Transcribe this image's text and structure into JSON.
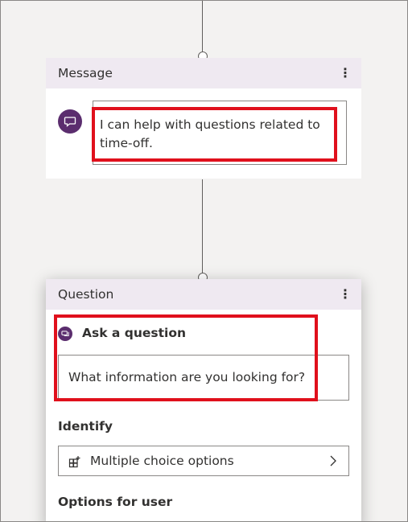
{
  "message_node": {
    "title": "Message",
    "menu_glyph": "⋮",
    "avatar_icon": "chat-bubble-icon",
    "text": "I can help with questions related to time-off."
  },
  "question_node": {
    "title": "Question",
    "menu_glyph": "⋮",
    "section_icon": "chat-bubbles-icon",
    "heading": "Ask a question",
    "question_text": "What information are you looking for?",
    "identify": {
      "label": "Identify",
      "value": "Multiple choice options",
      "icon": "grid-plus-icon"
    },
    "options_label": "Options for user"
  },
  "colors": {
    "header_bg": "#efe9f1",
    "accent_purple": "#5b2d6e",
    "highlight_red": "#e0101c",
    "canvas_bg": "#f3f2f1"
  }
}
